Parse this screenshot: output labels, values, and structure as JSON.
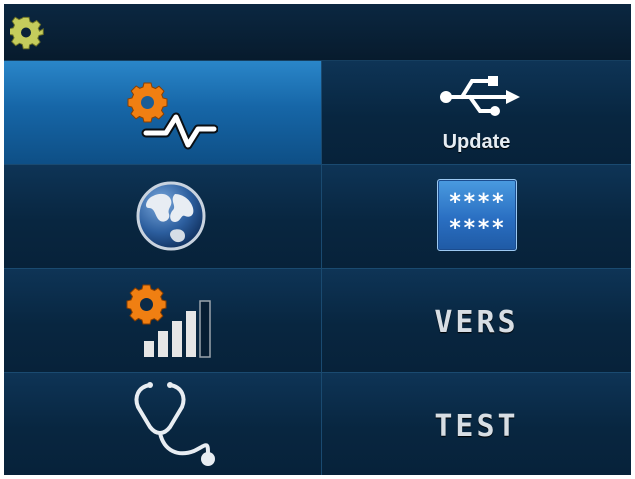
{
  "header": {
    "icon": "gear-icon"
  },
  "menu": {
    "tiles": [
      {
        "id": "network-settings",
        "icon": "gear-pulse-icon",
        "label": "",
        "selected": true
      },
      {
        "id": "update",
        "icon": "usb-icon",
        "label": "Update",
        "selected": false
      },
      {
        "id": "language",
        "icon": "globe-icon",
        "label": "",
        "selected": false
      },
      {
        "id": "password",
        "icon": "password-icon",
        "label": "",
        "selected": false
      },
      {
        "id": "signal-settings",
        "icon": "gear-signal-icon",
        "label": "",
        "selected": false
      },
      {
        "id": "version",
        "icon": "",
        "label": "VERS",
        "selected": false
      },
      {
        "id": "diagnostics",
        "icon": "stethoscope-icon",
        "label": "",
        "selected": false
      },
      {
        "id": "test",
        "icon": "",
        "label": "TEST",
        "selected": false
      }
    ],
    "password_mask": [
      "****",
      "****"
    ]
  },
  "colors": {
    "background": "#061d33",
    "selected_tile": "#1666a7",
    "gear_orange": "#f07f12",
    "gear_green": "#c2c95a"
  }
}
